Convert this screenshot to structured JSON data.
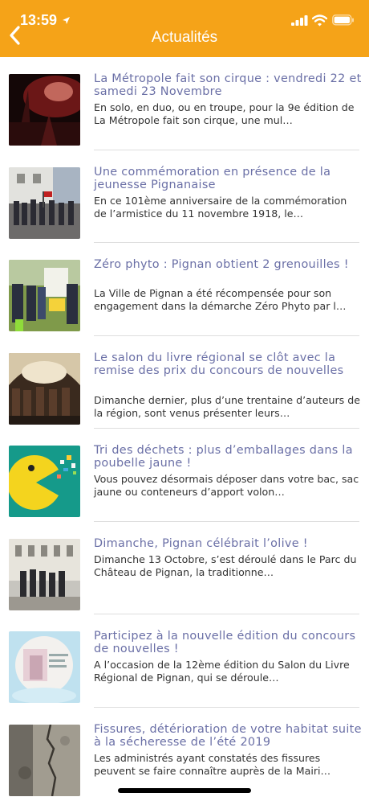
{
  "status_bar": {
    "time": "13:59"
  },
  "header": {
    "title": "Actualités"
  },
  "news": [
    {
      "title": "La Métropole fait son cirque : vendredi 22 et samedi 23 Novembre",
      "excerpt": "En solo, en duo, ou en troupe, pour la 9e édition de La Métropole fait son cirque, une mul…"
    },
    {
      "title": "Une commémoration en présence de la jeunesse Pignanaise",
      "excerpt": "En ce 101ème anniversaire de la commémoration de l’armistice du 11 novembre 1918, le…"
    },
    {
      "title": "Zéro phyto : Pignan obtient 2 grenouilles !",
      "excerpt": "La Ville de Pignan a été récompensée pour son engagement dans la démarche Zéro Phyto par l…"
    },
    {
      "title": "Le salon du livre régional se clôt avec la remise des prix du concours de nouvelles",
      "excerpt": "Dimanche dernier, plus d’une trentaine d’auteurs de la région, sont venus présenter leurs…"
    },
    {
      "title": "Tri des déchets : plus d’emballages dans la poubelle jaune !",
      "excerpt": "Vous pouvez désormais déposer dans votre bac, sac jaune ou conteneurs d’apport volon…"
    },
    {
      "title": "Dimanche, Pignan célébrait l’olive !",
      "excerpt": "Dimanche 13 Octobre, s’est déroulé dans le Parc du Château de Pignan, la traditionne…"
    },
    {
      "title": "Participez à la nouvelle édition du concours de nouvelles !",
      "excerpt": "A l’occasion de la 12ème édition du Salon du Livre Régional de Pignan, qui se déroule…"
    },
    {
      "title": "Fissures, détérioration de votre habitat suite à la sécheresse de l’été 2019",
      "excerpt": "Les administrés ayant constatés des fissures peuvent se faire connaître auprès de la Mairi…"
    }
  ],
  "colors": {
    "header": "#f5a318",
    "title": "#6a6fa6",
    "text": "#333333"
  }
}
